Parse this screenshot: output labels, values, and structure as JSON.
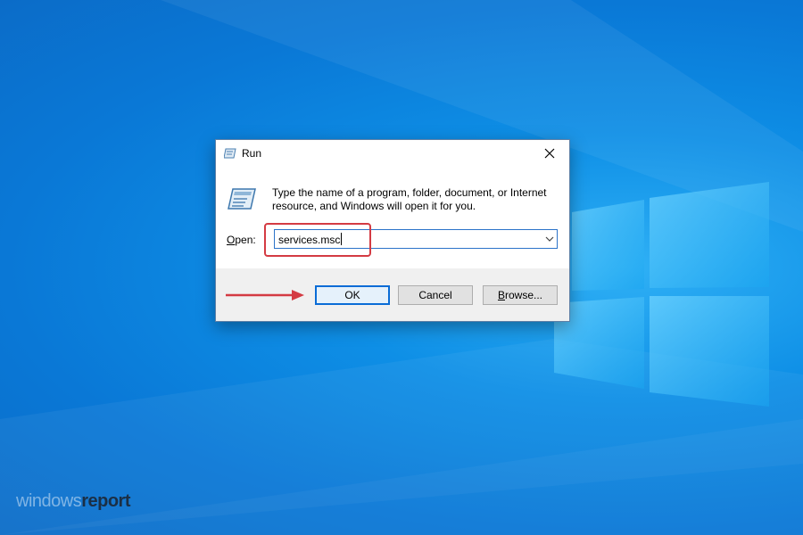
{
  "dialog": {
    "title": "Run",
    "description": "Type the name of a program, folder, document, or Internet resource, and Windows will open it for you.",
    "open_label_first": "O",
    "open_label_rest": "pen:",
    "open_value": "services.msc",
    "ok_label": "OK",
    "cancel_label": "Cancel",
    "browse_label_first": "B",
    "browse_label_rest": "rowse..."
  },
  "watermark": {
    "part1": "windows",
    "part2": "report"
  },
  "colors": {
    "accent": "#0a6cd6",
    "highlight": "#d43b43",
    "desktop": "#0a78d6"
  },
  "icons": {
    "title": "run-icon",
    "big": "run-icon",
    "close": "close-icon",
    "dropdown": "chevron-down-icon",
    "annotation": "arrow-right-icon"
  }
}
